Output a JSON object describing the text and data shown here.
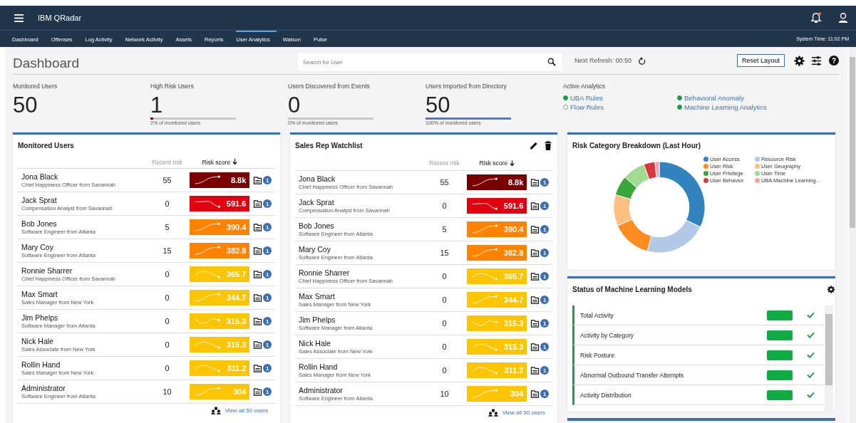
{
  "app": {
    "title": "IBM QRadar",
    "system_time": "System Time: 11:02 PM"
  },
  "nav": [
    {
      "label": "Dashboard",
      "selected": false
    },
    {
      "label": "Offenses",
      "selected": false
    },
    {
      "label": "Log Activity",
      "selected": false
    },
    {
      "label": "Network Activity",
      "selected": false
    },
    {
      "label": "Assets",
      "selected": false
    },
    {
      "label": "Reports",
      "selected": false
    },
    {
      "label": "User Analytics",
      "selected": true
    },
    {
      "label": "Watson",
      "selected": false
    },
    {
      "label": "Pulse",
      "selected": false
    }
  ],
  "toolbar": {
    "title": "Dashboard",
    "search": {
      "placeholder": "Search for User"
    },
    "refresh": "Next Refresh:  00:50",
    "reset": "Reset Layout",
    "help": "?"
  },
  "stats": [
    {
      "label": "Monitored Users",
      "value": "50"
    },
    {
      "label": "High Risk Users",
      "value": "1",
      "level": 0.02,
      "caption": "2% of monitored users",
      "color": "#8b0000"
    },
    {
      "label": "Users Discovered from Events",
      "value": "0",
      "caption": "0% of monitored users"
    },
    {
      "label": "Users Imported from Directory",
      "value": "50",
      "level": 1,
      "caption": "100% of monitored users",
      "color": "#4a7cc9"
    }
  ],
  "analytics": {
    "label": "Active Analytics",
    "items": [
      {
        "label": "UBA Rules",
        "on": true
      },
      {
        "label": "Behavioral Anomaly",
        "on": true
      },
      {
        "label": "Flow Rules",
        "on": false
      },
      {
        "label": "Machine Learning Analytics",
        "on": true
      }
    ]
  },
  "panels": [
    {
      "title": "Monitored Users",
      "editable": false,
      "columns": [
        "Recent risk",
        "Risk score"
      ],
      "footer": "View all 50 users",
      "rows": [
        {
          "name": "Jona Black",
          "title": "Chief Happiness Officer from Savannah",
          "recent": "55",
          "score": "8.8k",
          "color": "#7a0000",
          "kind": "rising",
          "notes": "1"
        },
        {
          "name": "Jack Sprat",
          "title": "Compensation Analyst from Savannah",
          "recent": "0",
          "score": "591.6",
          "color": "#e0000f",
          "kind": "drop",
          "notes": "1"
        },
        {
          "name": "Bob Jones",
          "title": "Software Engineer from Atlanta",
          "recent": "5",
          "score": "390.4",
          "color": "#ff8200",
          "kind": "rising",
          "notes": "1"
        },
        {
          "name": "Mary Coy",
          "title": "Software Engineer from Atlanta",
          "recent": "15",
          "score": "382.8",
          "color": "#ff8200",
          "kind": "rising",
          "notes": "1"
        },
        {
          "name": "Ronnie Sharrer",
          "title": "Chief Happiness Officer from Savannah",
          "recent": "0",
          "score": "365.7",
          "color": "#fdc500",
          "kind": "falling",
          "notes": "1"
        },
        {
          "name": "Max Smart",
          "title": "Sales Manager from New York",
          "recent": "0",
          "score": "344.7",
          "color": "#fdc500",
          "kind": "rising",
          "notes": "1"
        },
        {
          "name": "Jim Phelps",
          "title": "Software Manager from Atlanta",
          "recent": "0",
          "score": "315.3",
          "color": "#fdc500",
          "kind": "wave",
          "notes": "1"
        },
        {
          "name": "Nick Hale",
          "title": "Sales Associate from New York",
          "recent": "0",
          "score": "315.3",
          "color": "#fdc500",
          "kind": "falling",
          "notes": "1"
        },
        {
          "name": "Rollin Hand",
          "title": "Sales Manager from New York",
          "recent": "0",
          "score": "311.2",
          "color": "#fdc500",
          "kind": "falling",
          "notes": "1"
        },
        {
          "name": "Administrator",
          "title": "Software Engineer from Atlanta",
          "recent": "10",
          "score": "304",
          "color": "#fdc500",
          "kind": "rising",
          "notes": "1"
        }
      ]
    },
    {
      "title": "Sales Rep Watchlist",
      "editable": true,
      "columns": [
        "Recent risk",
        "Risk score"
      ],
      "footer": "View all 50 users",
      "rows": [
        {
          "name": "Jona Black",
          "title": "Chief Happiness Officer from Savannah",
          "recent": "55",
          "score": "8.8k",
          "color": "#7a0000",
          "kind": "rising",
          "notes": "1"
        },
        {
          "name": "Jack Sprat",
          "title": "Compensation Analyst from Savannah",
          "recent": "0",
          "score": "591.6",
          "color": "#e0000f",
          "kind": "drop",
          "notes": "1"
        },
        {
          "name": "Bob Jones",
          "title": "Software Engineer from Atlanta",
          "recent": "5",
          "score": "390.4",
          "color": "#ff8200",
          "kind": "rising",
          "notes": "1"
        },
        {
          "name": "Mary Coy",
          "title": "Software Engineer from Atlanta",
          "recent": "15",
          "score": "382.8",
          "color": "#ff8200",
          "kind": "rising",
          "notes": "1"
        },
        {
          "name": "Ronnie Sharrer",
          "title": "Chief Happiness Officer from Savannah",
          "recent": "0",
          "score": "365.7",
          "color": "#fdc500",
          "kind": "falling",
          "notes": "1"
        },
        {
          "name": "Max Smart",
          "title": "Sales Manager from New York",
          "recent": "0",
          "score": "344.7",
          "color": "#fdc500",
          "kind": "rising",
          "notes": "1"
        },
        {
          "name": "Jim Phelps",
          "title": "Software Manager from Atlanta",
          "recent": "0",
          "score": "315.3",
          "color": "#fdc500",
          "kind": "wave",
          "notes": "1"
        },
        {
          "name": "Nick Hale",
          "title": "Sales Associate from New York",
          "recent": "0",
          "score": "315.3",
          "color": "#fdc500",
          "kind": "falling",
          "notes": "1"
        },
        {
          "name": "Rollin Hand",
          "title": "Sales Manager from New York",
          "recent": "0",
          "score": "311.2",
          "color": "#fdc500",
          "kind": "falling",
          "notes": "1"
        },
        {
          "name": "Administrator",
          "title": "Software Engineer from Atlanta",
          "recent": "10",
          "score": "304",
          "color": "#fdc500",
          "kind": "rising",
          "notes": "1"
        }
      ]
    }
  ],
  "risk_breakdown": {
    "title": "Risk Category Breakdown (Last Hour)",
    "legend": [
      {
        "label": "User Access",
        "color": "#3182bd"
      },
      {
        "label": "Resource Risk",
        "color": "#b3c9e8"
      },
      {
        "label": "User Risk",
        "color": "#ff8c1f"
      },
      {
        "label": "User Geography",
        "color": "#ffbf80"
      },
      {
        "label": "User Privilege",
        "color": "#3aa63a"
      },
      {
        "label": "User Time",
        "color": "#9fdc92"
      },
      {
        "label": "User Behavior",
        "color": "#d9363e"
      },
      {
        "label": "UBA Machine Learning...",
        "color": "#ffa0a8"
      }
    ]
  },
  "ml_models": {
    "title": "Status of Machine Learning Models",
    "rows": [
      {
        "name": "Total Activity",
        "healthy": true
      },
      {
        "name": "Activity by Category",
        "healthy": true
      },
      {
        "name": "Risk Posture",
        "healthy": true
      },
      {
        "name": "Abnormal Outbound Transfer Attempts",
        "healthy": true
      },
      {
        "name": "Activity Distribution",
        "healthy": true
      }
    ]
  }
}
